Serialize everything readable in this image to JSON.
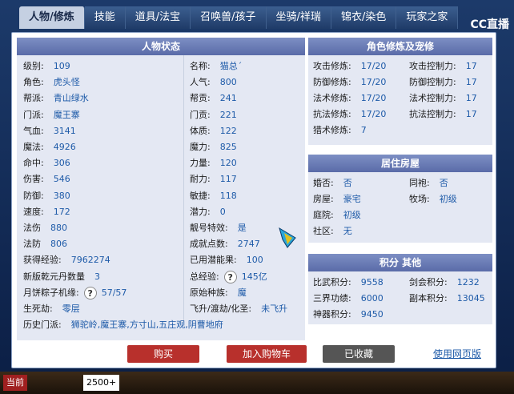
{
  "tabs": [
    "人物/修炼",
    "技能",
    "道具/法宝",
    "召唤兽/孩子",
    "坐骑/祥瑞",
    "锦衣/染色",
    "玩家之家"
  ],
  "logo": "CC直播",
  "left": {
    "title": "人物状态",
    "col1": [
      [
        "级别:",
        "109"
      ],
      [
        "角色:",
        "虎头怪"
      ],
      [
        "帮派:",
        "青山绿水"
      ],
      [
        "门派:",
        "魔王寨"
      ],
      [
        "气血:",
        "3141"
      ],
      [
        "魔法:",
        "4926"
      ],
      [
        "命中:",
        "306"
      ],
      [
        "伤害:",
        "546"
      ],
      [
        "防御:",
        "380"
      ],
      [
        "速度:",
        "172"
      ],
      [
        "法伤",
        "880"
      ],
      [
        "法防",
        "806"
      ],
      [
        "获得经验:",
        "7962274"
      ],
      [
        "新版乾元丹数量",
        "3"
      ],
      [
        "月饼粽子机缘:",
        "57/57"
      ],
      [
        "生死劫:",
        "零层"
      ],
      [
        "历史门派:",
        "狮驼岭,魔王寨,方寸山,五庄观,阴曹地府"
      ]
    ],
    "col2": [
      [
        "名称:",
        "猫总´"
      ],
      [
        "人气:",
        "800"
      ],
      [
        "帮贡:",
        "241"
      ],
      [
        "门贡:",
        "221"
      ],
      [
        "体质:",
        "122"
      ],
      [
        "魔力:",
        "825"
      ],
      [
        "力量:",
        "120"
      ],
      [
        "耐力:",
        "117"
      ],
      [
        "敏捷:",
        "118"
      ],
      [
        "潜力:",
        "0"
      ],
      [
        "靓号特效:",
        "是"
      ],
      [
        "成就点数:",
        "2747"
      ],
      [
        "已用潜能果:",
        "100"
      ],
      [
        "总经验:",
        "145亿"
      ],
      [
        "原始种族:",
        "魔"
      ],
      [
        "飞升/渡劫/化圣:",
        "未飞升"
      ]
    ]
  },
  "right": {
    "title": "角色修炼及宠修",
    "cult": [
      [
        "攻击修炼:",
        "17/20",
        "攻击控制力:",
        "17"
      ],
      [
        "防御修炼:",
        "17/20",
        "防御控制力:",
        "17"
      ],
      [
        "法术修炼:",
        "17/20",
        "法术控制力:",
        "17"
      ],
      [
        "抗法修炼:",
        "17/20",
        "抗法控制力:",
        "17"
      ],
      [
        "猎术修炼:",
        "7",
        "",
        ""
      ]
    ],
    "home_title": "居住房屋",
    "home": [
      [
        "婚否:",
        "否",
        "同袍:",
        "否"
      ],
      [
        "房屋:",
        "豪宅",
        "牧场:",
        "初级"
      ],
      [
        "庭院:",
        "初级",
        "",
        ""
      ],
      [
        "社区:",
        "无",
        "",
        ""
      ]
    ],
    "score_title": "积分 其他",
    "score": [
      [
        "比武积分:",
        "9558",
        "剑会积分:",
        "1232"
      ],
      [
        "三界功绩:",
        "6000",
        "副本积分:",
        "13045"
      ],
      [
        "神器积分:",
        "9450",
        "",
        ""
      ]
    ]
  },
  "buttons": {
    "buy": "购买",
    "cart": "加入购物车",
    "fav": "已收藏",
    "web": "使用网页版"
  },
  "bottom": {
    "a": "当前",
    "b": "2500+"
  },
  "colors": {
    "buy": "#b8302c",
    "cart": "#b8302c",
    "fav": "#555555"
  }
}
